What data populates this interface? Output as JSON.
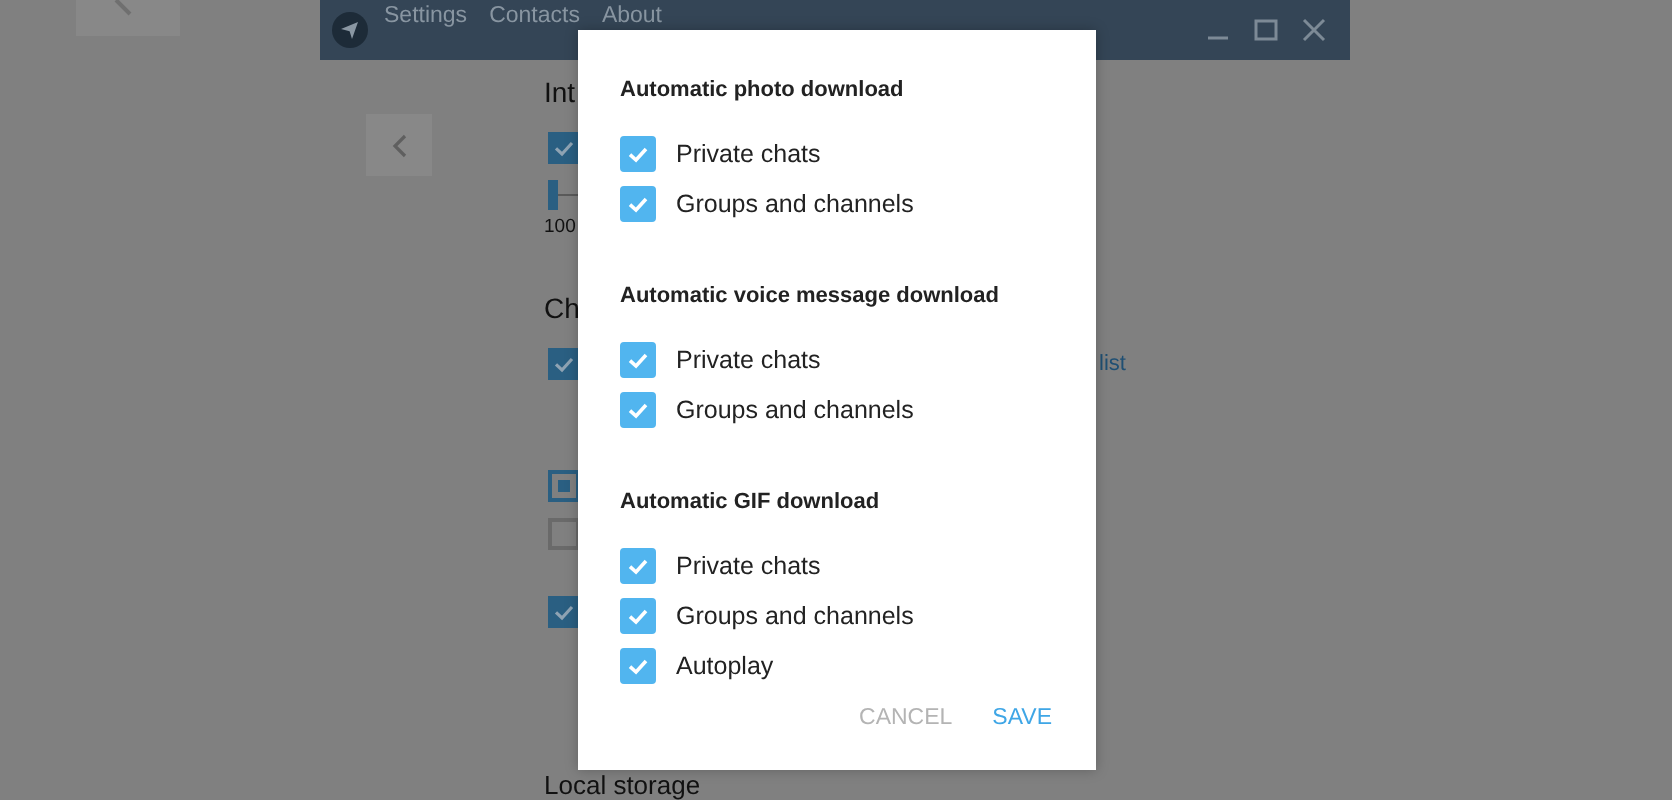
{
  "window": {
    "menu": [
      {
        "label": "Settings"
      },
      {
        "label": "Contacts"
      },
      {
        "label": "About"
      }
    ]
  },
  "settings": [
    {
      "kind": "heading",
      "text": "Int"
    },
    {
      "kind": "checkbox",
      "checked": true
    },
    {
      "kind": "slider",
      "level": 0
    },
    {
      "kind": "value",
      "text": "100"
    },
    {
      "kind": "heading",
      "text": "Ch"
    },
    {
      "kind": "checkbox",
      "checked": true,
      "link": "list"
    },
    {
      "kind": "radio",
      "selected": true
    },
    {
      "kind": "radio",
      "selected": false
    },
    {
      "kind": "checkbox",
      "checked": true
    },
    {
      "kind": "heading",
      "text": "Local storage"
    }
  ],
  "dialog": {
    "sections": [
      {
        "title": "Automatic photo download",
        "options": [
          {
            "label": "Private chats",
            "checked": true
          },
          {
            "label": "Groups and channels",
            "checked": true
          }
        ]
      },
      {
        "title": "Automatic voice message download",
        "options": [
          {
            "label": "Private chats",
            "checked": true
          },
          {
            "label": "Groups and channels",
            "checked": true
          }
        ]
      },
      {
        "title": "Automatic GIF download",
        "options": [
          {
            "label": "Private chats",
            "checked": true
          },
          {
            "label": "Groups and channels",
            "checked": true
          },
          {
            "label": "Autoplay",
            "checked": true
          }
        ]
      }
    ],
    "buttons": [
      {
        "label": "CANCEL",
        "kind": "cancel"
      },
      {
        "label": "SAVE",
        "kind": "save"
      }
    ]
  }
}
